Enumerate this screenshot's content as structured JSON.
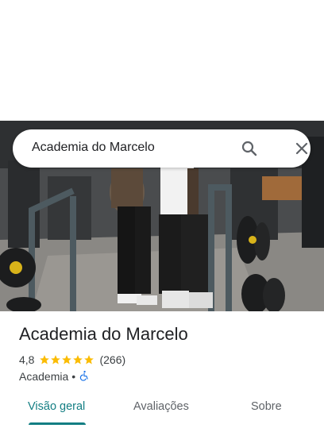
{
  "search": {
    "query": "Academia do Marcelo"
  },
  "place": {
    "name": "Academia do Marcelo",
    "rating": "4,8",
    "stars": 5,
    "reviews": "(266)",
    "category": "Academia",
    "separator": "•"
  },
  "tabs": [
    {
      "label": "Visão geral",
      "active": true
    },
    {
      "label": "Avaliações",
      "active": false
    },
    {
      "label": "Sobre",
      "active": false
    }
  ],
  "colors": {
    "accent": "#137e83",
    "star": "#fbbc04",
    "accessibility_icon": "#1a73e8"
  },
  "icons": {
    "search": "search-icon",
    "close": "close-icon",
    "accessibility": "wheelchair-icon"
  }
}
